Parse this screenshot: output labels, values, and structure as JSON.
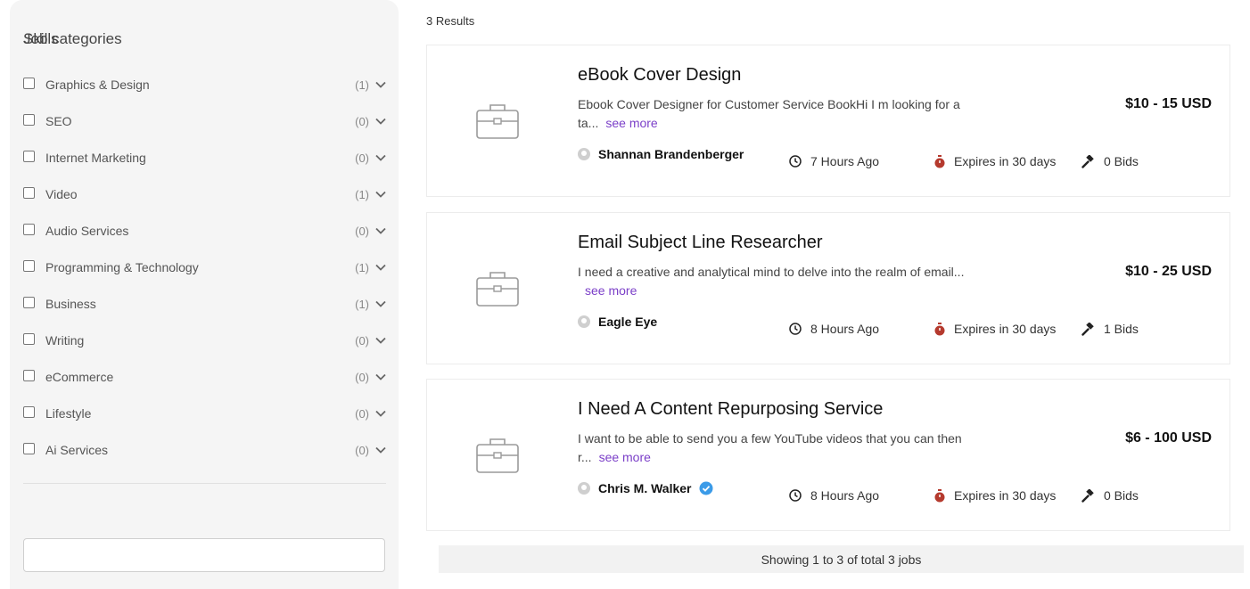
{
  "sidebar": {
    "title": "Job categories",
    "categories": [
      {
        "label": "Graphics & Design",
        "count": "(1)"
      },
      {
        "label": "SEO",
        "count": "(0)"
      },
      {
        "label": "Internet Marketing",
        "count": "(0)"
      },
      {
        "label": "Video",
        "count": "(1)"
      },
      {
        "label": "Audio Services",
        "count": "(0)"
      },
      {
        "label": "Programming & Technology",
        "count": "(1)"
      },
      {
        "label": "Business",
        "count": "(1)"
      },
      {
        "label": "Writing",
        "count": "(0)"
      },
      {
        "label": "eCommerce",
        "count": "(0)"
      },
      {
        "label": "Lifestyle",
        "count": "(0)"
      },
      {
        "label": "Ai Services",
        "count": "(0)"
      }
    ],
    "skills_title": "Skills",
    "skills_input_value": ""
  },
  "results": {
    "count_label": "3 Results",
    "see_more_label": "see more",
    "jobs": [
      {
        "title": "eBook Cover Design",
        "desc_line1": "Ebook Cover Designer for Customer Service BookHi I m looking for a",
        "desc_line2": "ta...",
        "price": "$10 - 15 USD",
        "author": "Shannan Brandenberger",
        "verified": false,
        "posted": "7 Hours Ago",
        "expires": "Expires in 30 days",
        "bids": "0 Bids"
      },
      {
        "title": "Email Subject Line Researcher",
        "desc_line1": "I need a creative and analytical mind to delve into the realm of email...",
        "desc_line2": "",
        "price": "$10 - 25 USD",
        "author": "Eagle Eye",
        "verified": false,
        "posted": "8 Hours Ago",
        "expires": "Expires in 30 days",
        "bids": "1 Bids"
      },
      {
        "title": "I Need A Content Repurposing Service",
        "desc_line1": "I want to be able to send you a few YouTube videos that you can then",
        "desc_line2": "r...",
        "price": "$6 - 100 USD",
        "author": "Chris M. Walker",
        "verified": true,
        "posted": "8 Hours Ago",
        "expires": "Expires in 30 days",
        "bids": "0 Bids"
      }
    ]
  },
  "footer": {
    "summary": "Showing 1 to 3 of total 3 jobs"
  },
  "colors": {
    "accent_link": "#7b3fc8",
    "verified_badge": "#3b9be8",
    "timer_icon": "#b53a2e"
  }
}
